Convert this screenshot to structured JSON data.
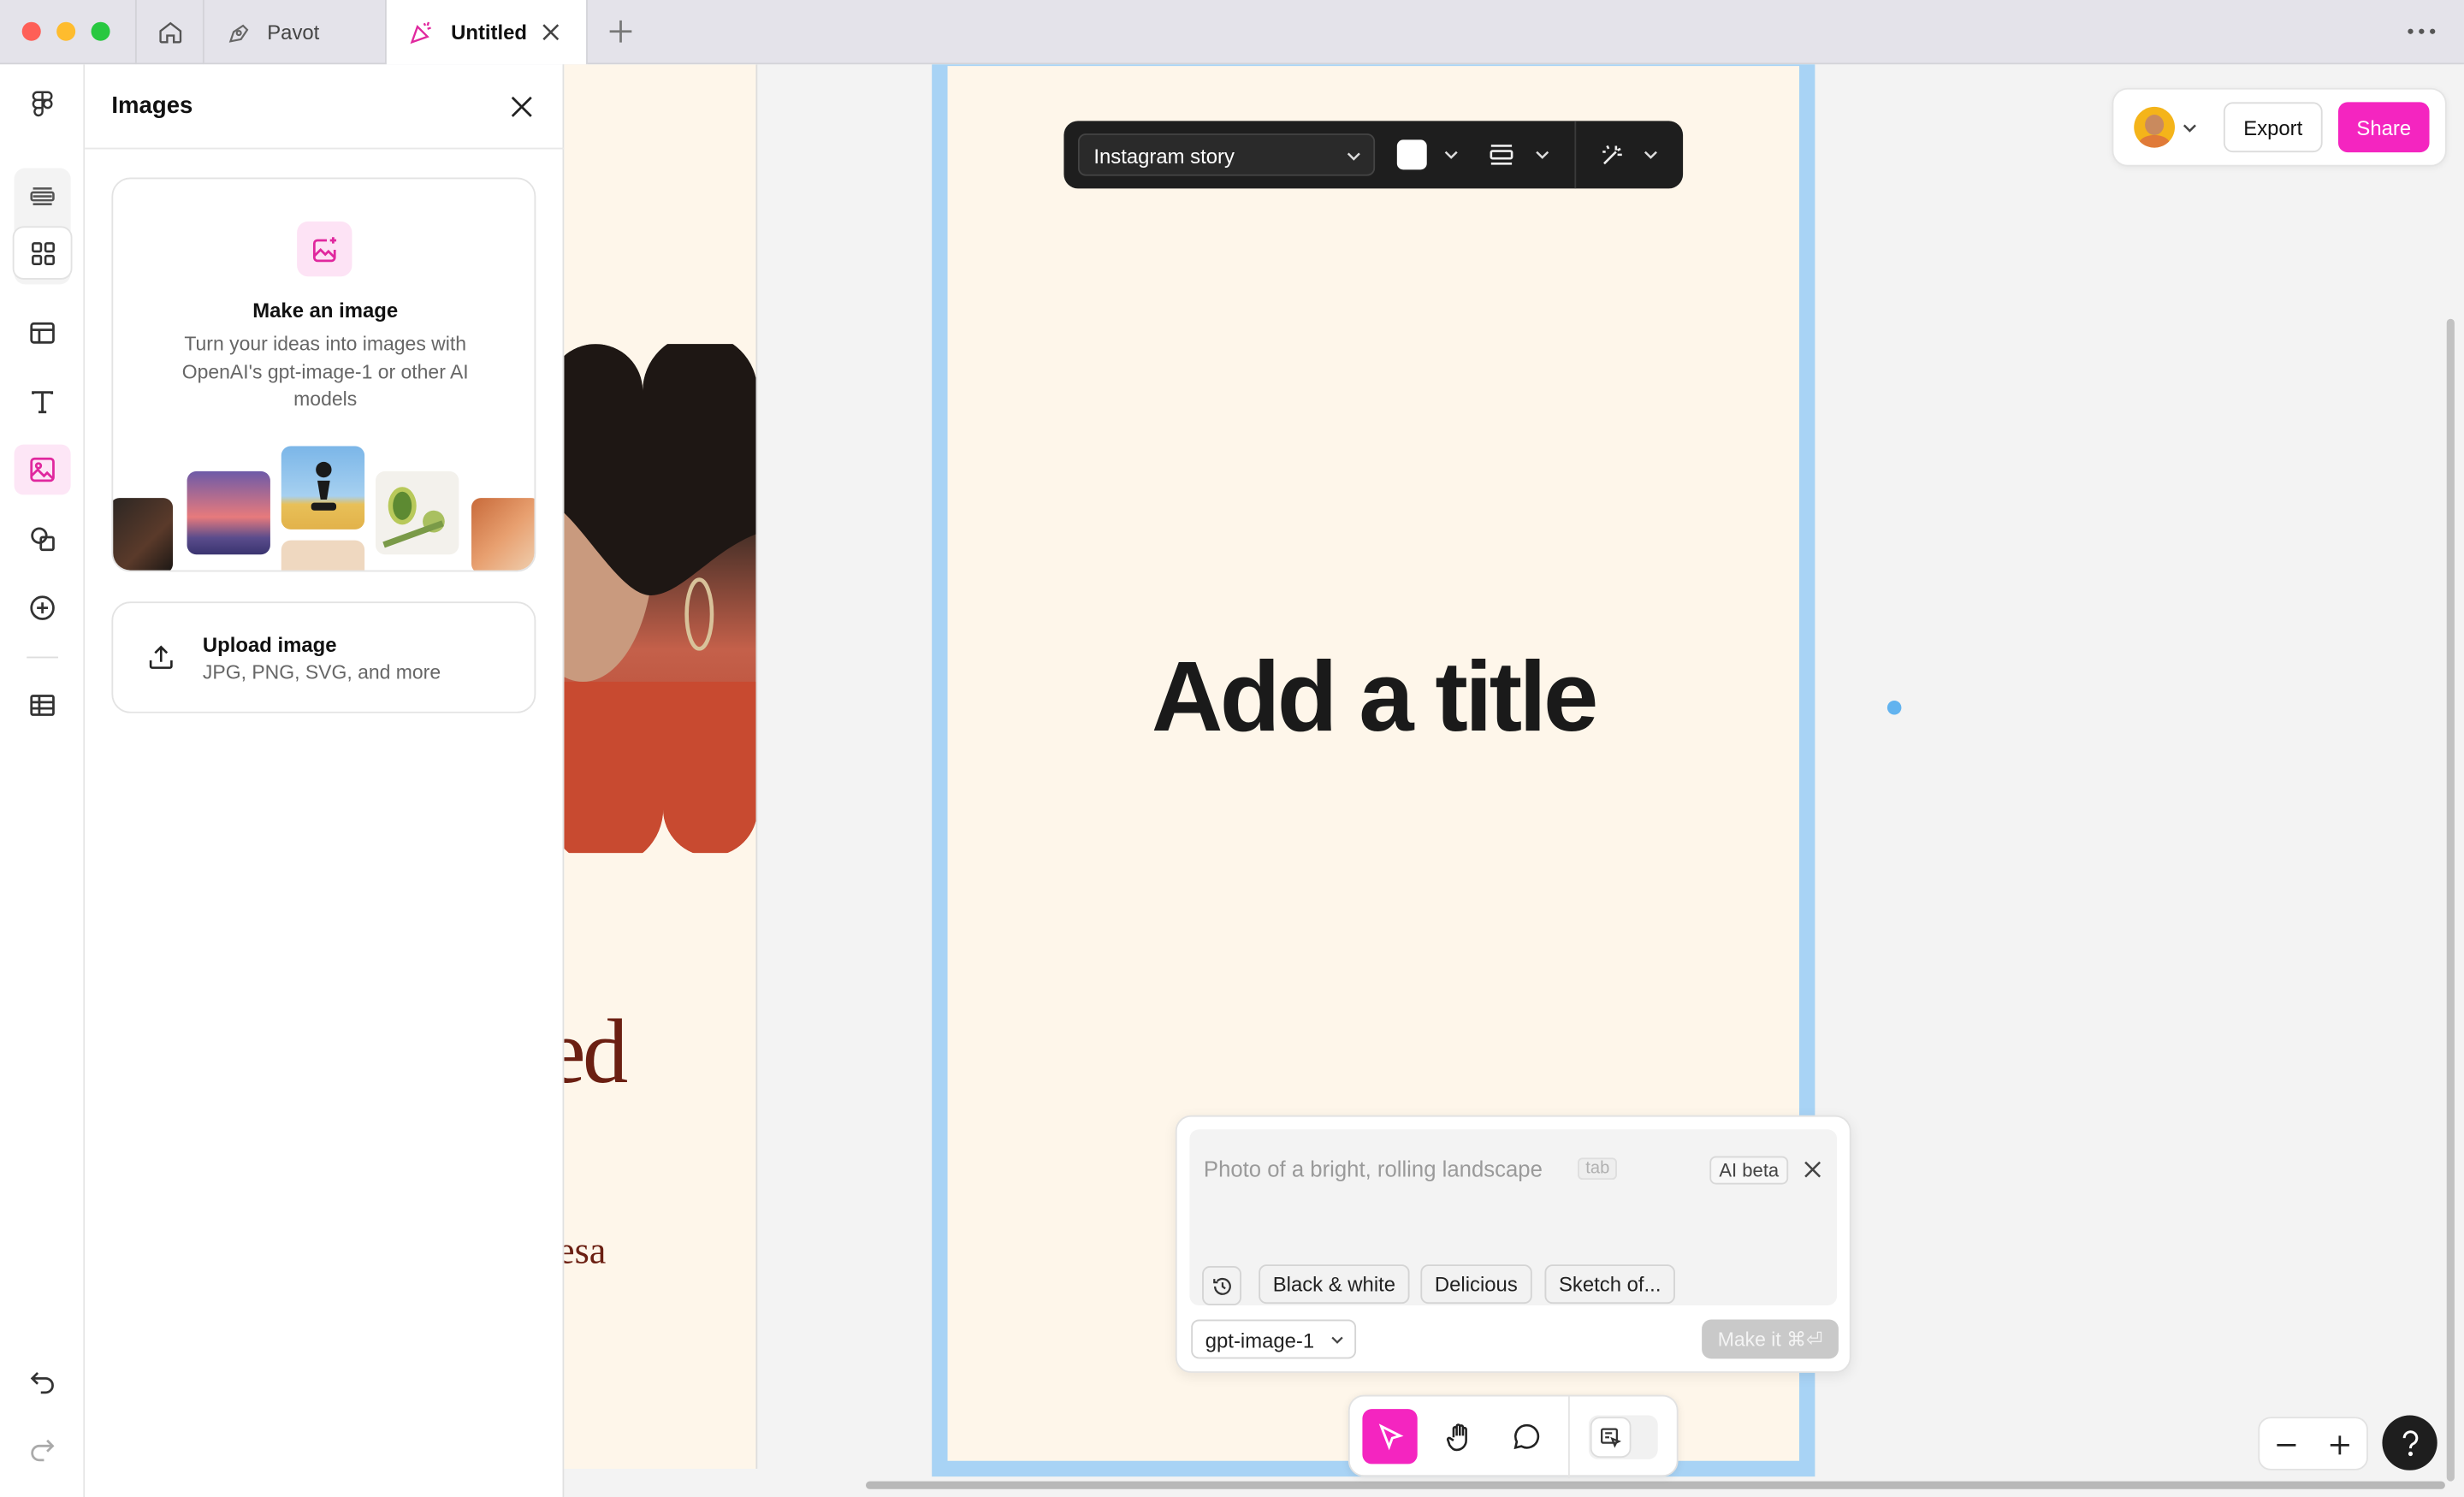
{
  "titlebar": {
    "tabs": [
      {
        "label": "Pavot"
      },
      {
        "label": "Untitled"
      }
    ]
  },
  "panel": {
    "title": "Images",
    "make_image": {
      "title": "Make an image",
      "description": "Turn your ideas into images with OpenAI's gpt-image-1 or other AI models"
    },
    "upload": {
      "title": "Upload image",
      "subtitle": "JPG, PNG, SVG, and more"
    }
  },
  "canvas": {
    "left_frame_text": {
      "line1": "ed",
      "line2": "esa"
    },
    "frame_title": "Add a title"
  },
  "frame_toolbar": {
    "size_preset": "Instagram story",
    "swatch_color": "#ffffff"
  },
  "top_right": {
    "export_label": "Export",
    "share_label": "Share"
  },
  "ai_prompt": {
    "placeholder": "Photo of a bright, rolling landscape",
    "tab_hint": "tab",
    "badge": "AI beta",
    "suggestions": [
      "Black & white",
      "Delicious",
      "Sketch of..."
    ],
    "model": "gpt-image-1",
    "submit_label": "Make it ⌘⏎"
  },
  "colors": {
    "accent": "#f425c0",
    "frame_bg": "#fef6ea",
    "selection": "#a8d3f5",
    "dark_text": "#1a1a1a",
    "brown_text": "#6b1f12"
  }
}
